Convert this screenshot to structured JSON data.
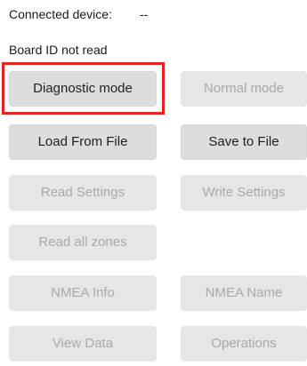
{
  "status": {
    "connected_label": "Connected device:",
    "connected_value": "--",
    "board_id": "Board ID not read"
  },
  "buttons": {
    "diagnostic_mode": "Diagnostic mode",
    "normal_mode": "Normal mode",
    "load_from_file": "Load From File",
    "save_to_file": "Save to File",
    "read_settings": "Read Settings",
    "write_settings": "Write Settings",
    "read_all_zones": "Read all zones",
    "nmea_info": "NMEA Info",
    "nmea_name": "NMEA Name",
    "view_data": "View Data",
    "operations": "Operations"
  },
  "highlight": {
    "target": "Diagnostic mode",
    "color": "#e52420"
  },
  "colors": {
    "button_enabled_bg": "#dddddd",
    "button_disabled_bg": "#e6e6e6",
    "disabled_text": "#a9a9a9"
  }
}
